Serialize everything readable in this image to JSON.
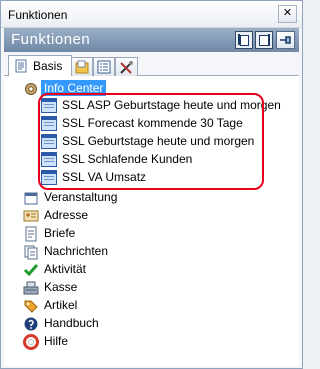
{
  "window": {
    "title": "Funktionen",
    "close_icon": "close-icon"
  },
  "header": {
    "title": "Funktionen"
  },
  "tabs": [
    {
      "label": "Basis",
      "icon": "document-icon",
      "active": true
    },
    {
      "label": "",
      "icon": "folder-icon",
      "active": false
    },
    {
      "label": "",
      "icon": "list-icon",
      "active": false
    },
    {
      "label": "",
      "icon": "tools-icon",
      "active": false
    }
  ],
  "tree": {
    "info_center": "Info Center",
    "reports": [
      "SSL ASP Geburtstage heute und morgen",
      "SSL Forecast kommende 30 Tage",
      "SSL Geburtstage heute und morgen",
      "SSL Schlafende Kunden",
      "SSL VA Umsatz"
    ],
    "items": [
      {
        "label": "Veranstaltung",
        "icon": "calendar-icon"
      },
      {
        "label": "Adresse",
        "icon": "address-card-icon"
      },
      {
        "label": "Briefe",
        "icon": "letter-icon"
      },
      {
        "label": "Nachrichten",
        "icon": "messages-icon"
      },
      {
        "label": "Aktivität",
        "icon": "checkmark-icon"
      },
      {
        "label": "Kasse",
        "icon": "cash-register-icon"
      },
      {
        "label": "Artikel",
        "icon": "tag-icon"
      },
      {
        "label": "Handbuch",
        "icon": "help-book-icon"
      },
      {
        "label": "Hilfe",
        "icon": "lifebuoy-icon"
      }
    ]
  },
  "colors": {
    "header": "#7f96b3",
    "selection": "#3399ff",
    "highlight": "#e8001c"
  }
}
